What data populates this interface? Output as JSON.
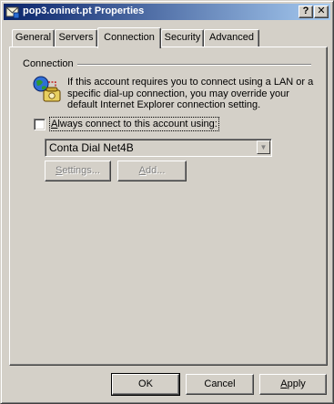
{
  "window": {
    "title": "pop3.oninet.pt Properties",
    "help_button": "?",
    "close_button": "✕"
  },
  "tabs": [
    {
      "label": "General",
      "active": false
    },
    {
      "label": "Servers",
      "active": false
    },
    {
      "label": "Connection",
      "active": true
    },
    {
      "label": "Security",
      "active": false
    },
    {
      "label": "Advanced",
      "active": false
    }
  ],
  "connection": {
    "group_label": "Connection",
    "description": "If this account requires you to connect using a LAN or a specific dial-up connection, you may override your default Internet Explorer connection setting.",
    "checkbox_label": "Always connect to this account using:",
    "checkbox_checked": false,
    "dialup_selected": "Conta Dial Net4B",
    "settings_button": "Settings...",
    "add_button": "Add..."
  },
  "footer": {
    "ok": "OK",
    "cancel": "Cancel",
    "apply": "Apply"
  },
  "colors": {
    "dialog_bg": "#d4d0c8",
    "titlebar_start": "#0a246a",
    "titlebar_end": "#a6caf0",
    "disabled_text": "#808080"
  }
}
